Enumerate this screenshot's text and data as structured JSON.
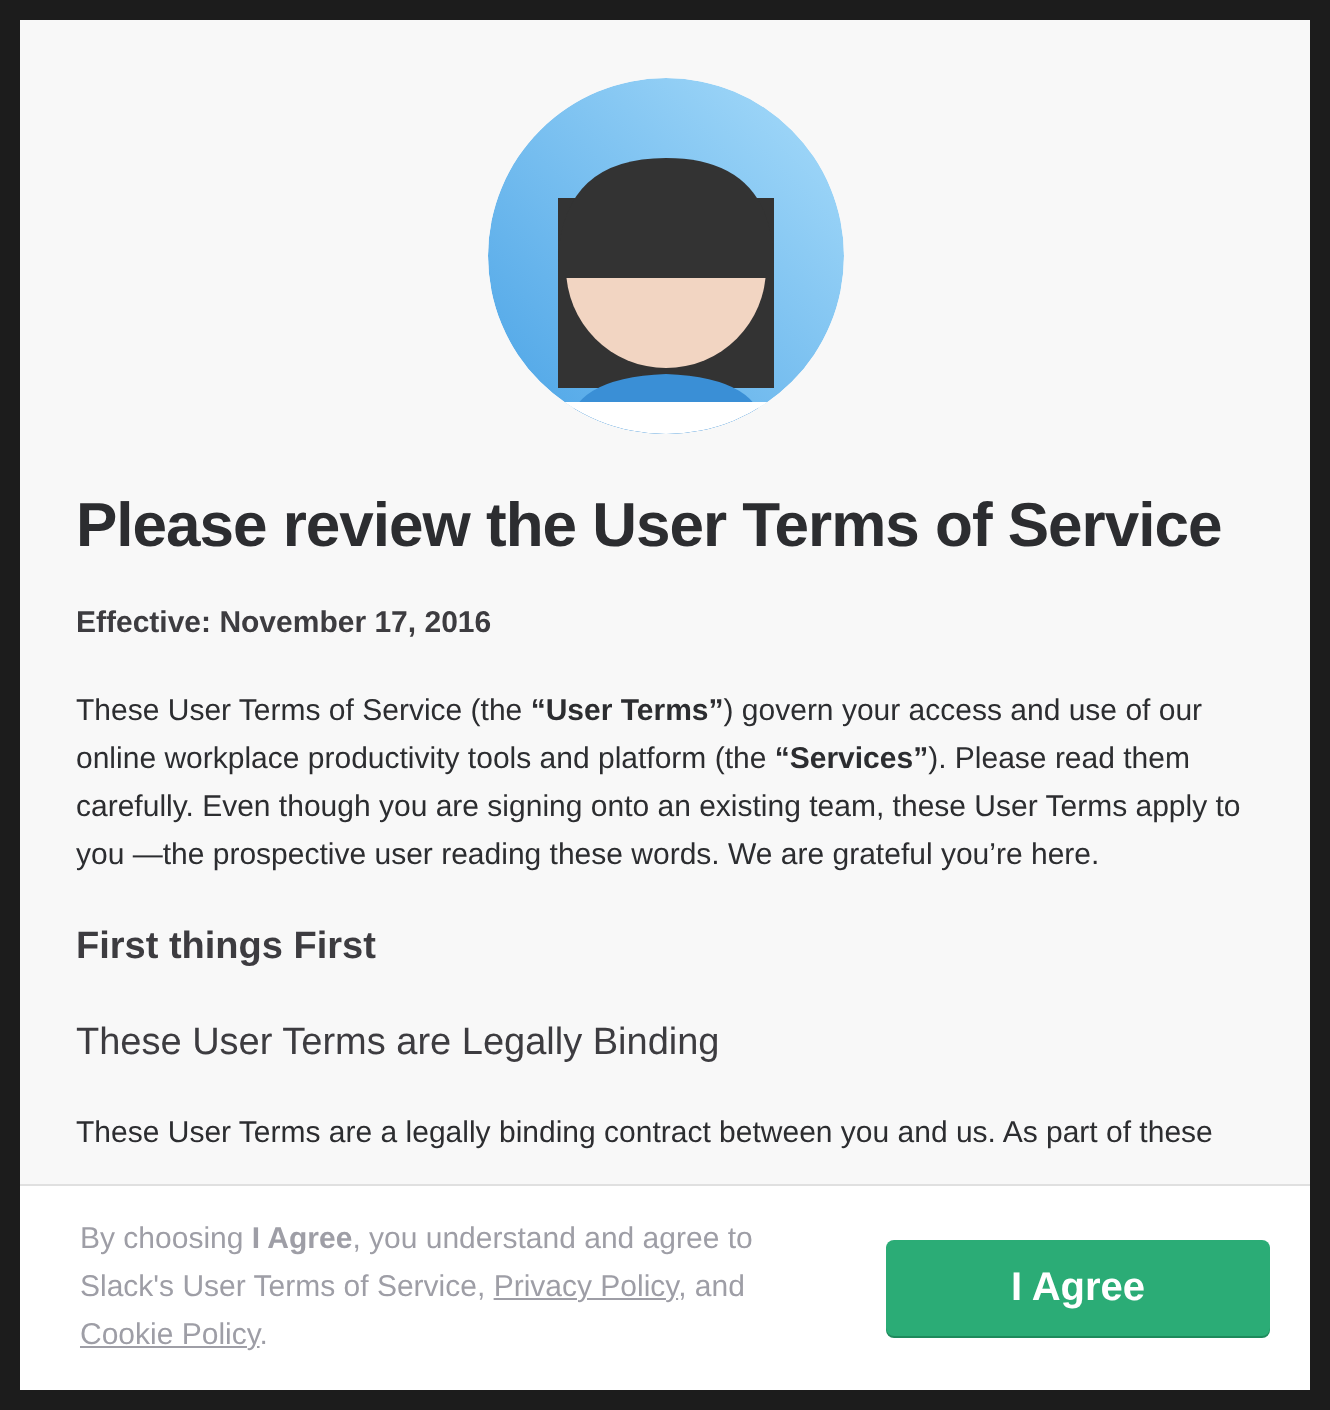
{
  "title": "Please review the User Terms of Service",
  "effective": "Effective: November 17, 2016",
  "intro": "These User Terms of Service (the **“User Terms”**) govern your access and use of our online workplace productivity tools and platform (the **“Services”**). Please read them carefully. Even though you are signing onto an existing team, these User Terms apply to you —the prospective user reading these words. We are grateful you’re here.",
  "section_heading": "First things First",
  "subsection_heading": "These User Terms are Legally Binding",
  "body": "These User Terms are a legally binding contract between you and us. As part of these",
  "footer": {
    "consent": [
      {
        "kind": "text",
        "text": "By choosing **I Agree**, you understand and agree to Slack's User Terms of Service, "
      },
      {
        "kind": "link",
        "text": "Privacy Policy"
      },
      {
        "kind": "text",
        "text": ", and "
      },
      {
        "kind": "link",
        "text": "Cookie Policy"
      },
      {
        "kind": "text",
        "text": "."
      }
    ],
    "button": "I Agree"
  }
}
